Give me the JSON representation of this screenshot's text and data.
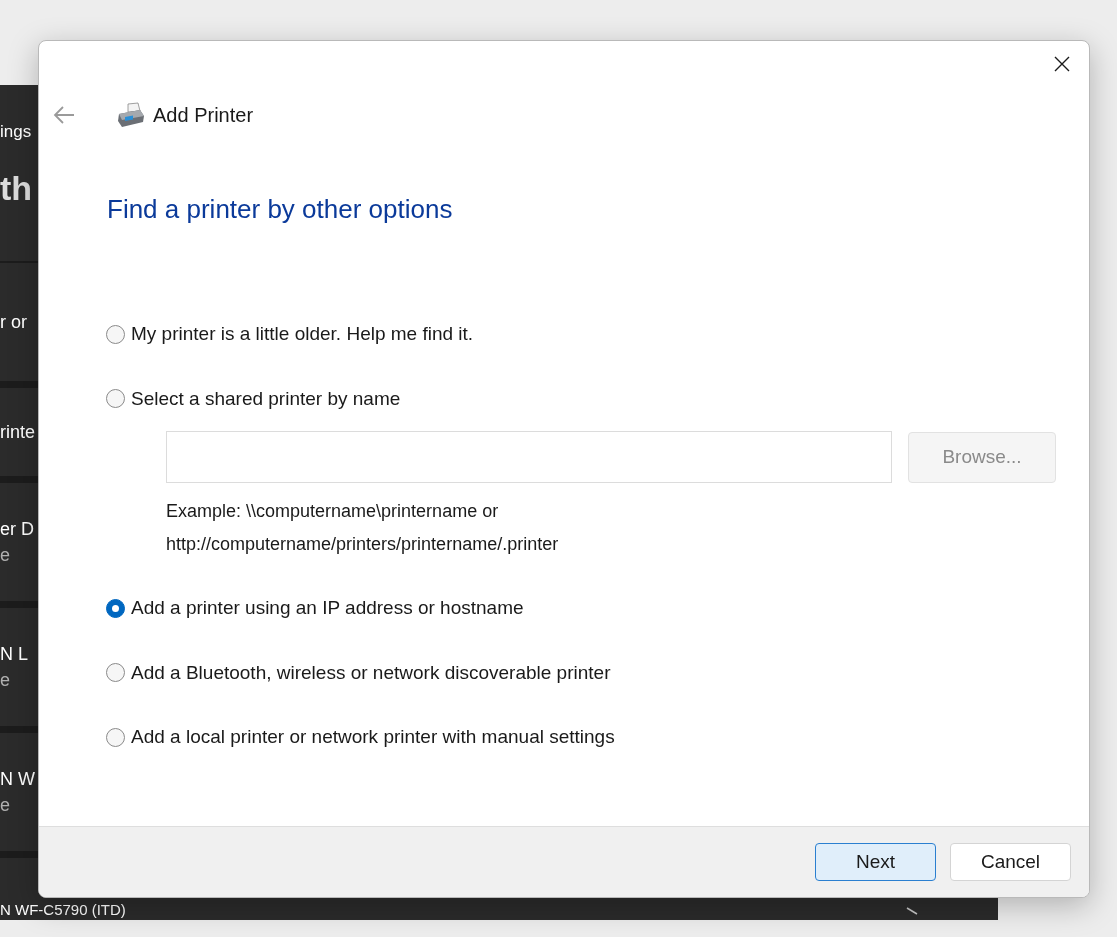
{
  "background_window": {
    "breadcrumb": "ings",
    "title": "th",
    "items": [
      {
        "lines": [
          "r or"
        ]
      },
      {
        "lines": [
          "rinte"
        ]
      },
      {
        "lines": [
          "er D",
          "e"
        ]
      },
      {
        "lines": [
          "N L",
          "e"
        ]
      },
      {
        "lines": [
          "N W",
          "e"
        ]
      },
      {
        "lines": [
          "N WF-C5790 (ITD)"
        ]
      }
    ]
  },
  "dialog": {
    "title": "Add Printer",
    "heading": "Find a printer by other options",
    "options": [
      {
        "label": "My printer is a little older. Help me find it.",
        "selected": false
      },
      {
        "label": "Select a shared printer by name",
        "selected": false,
        "name_field": {
          "browse_button": {
            "label": "Browse...",
            "disabled": true
          },
          "example": [
            "Example: \\\\computername\\printername or",
            "http://computername/printers/printername/.printer"
          ]
        }
      },
      {
        "label": "Add a printer using an IP address or hostname",
        "selected": true
      },
      {
        "label": "Add a Bluetooth, wireless or network discoverable printer",
        "selected": false
      },
      {
        "label": "Add a local printer or network printer with manual settings",
        "selected": false
      }
    ],
    "buttons": [
      {
        "label": "Next",
        "default": true
      },
      {
        "label": "Cancel",
        "default": false
      }
    ]
  }
}
